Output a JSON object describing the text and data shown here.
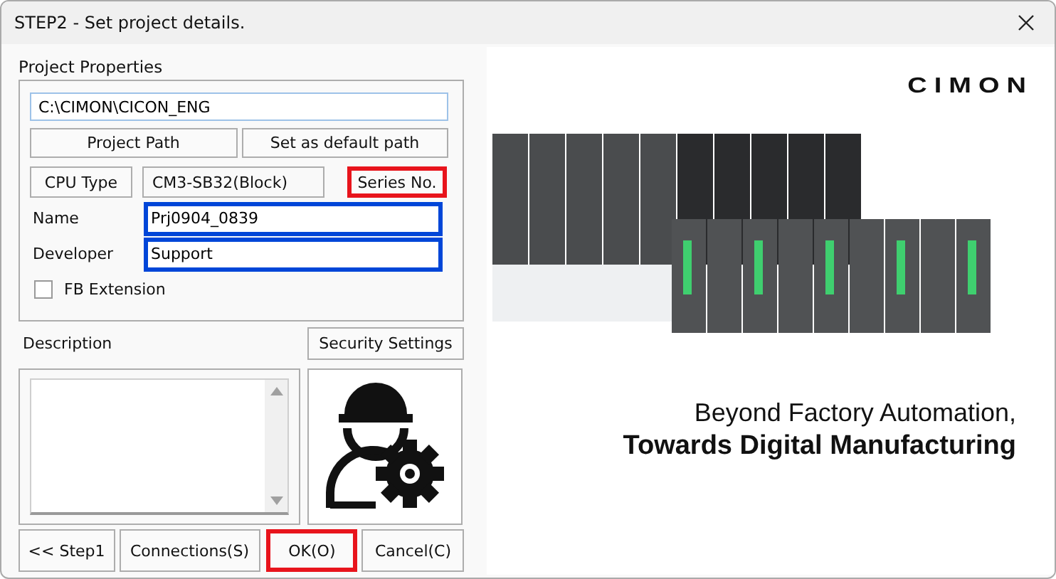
{
  "window": {
    "title": "STEP2 - Set project details."
  },
  "project_properties": {
    "title": "Project Properties",
    "path": "C:\\CIMON\\CICON_ENG",
    "path_buttons": [
      {
        "label": "Project Path"
      },
      {
        "label": "Set as default path"
      }
    ],
    "cpu_type_button": {
      "label": "CPU Type"
    },
    "cpu_type_value": "CM3-SB32(Block)",
    "series_button": {
      "label": "Series No.",
      "color": "#e8141c"
    },
    "fields": [
      {
        "label": "Name",
        "value": "Prj0904_0839",
        "color": "#0046d8"
      },
      {
        "label": "Developer",
        "value": "Support",
        "color": "#0046d8"
      }
    ],
    "fb_extension": {
      "label": "FB Extension",
      "checked": false
    }
  },
  "description": {
    "label": "Description"
  },
  "security_button": {
    "label": "Security Settings"
  },
  "buttons": [
    {
      "label": "<< Step1"
    },
    {
      "label": "Connections(S)"
    },
    {
      "label": "OK(O)",
      "color": "#e8141c"
    },
    {
      "label": "Cancel(C)"
    }
  ],
  "banner": {
    "logo": "CIMON",
    "tagline": "Beyond Factory Automation,",
    "headline": "Towards Digital Manufacturing"
  }
}
